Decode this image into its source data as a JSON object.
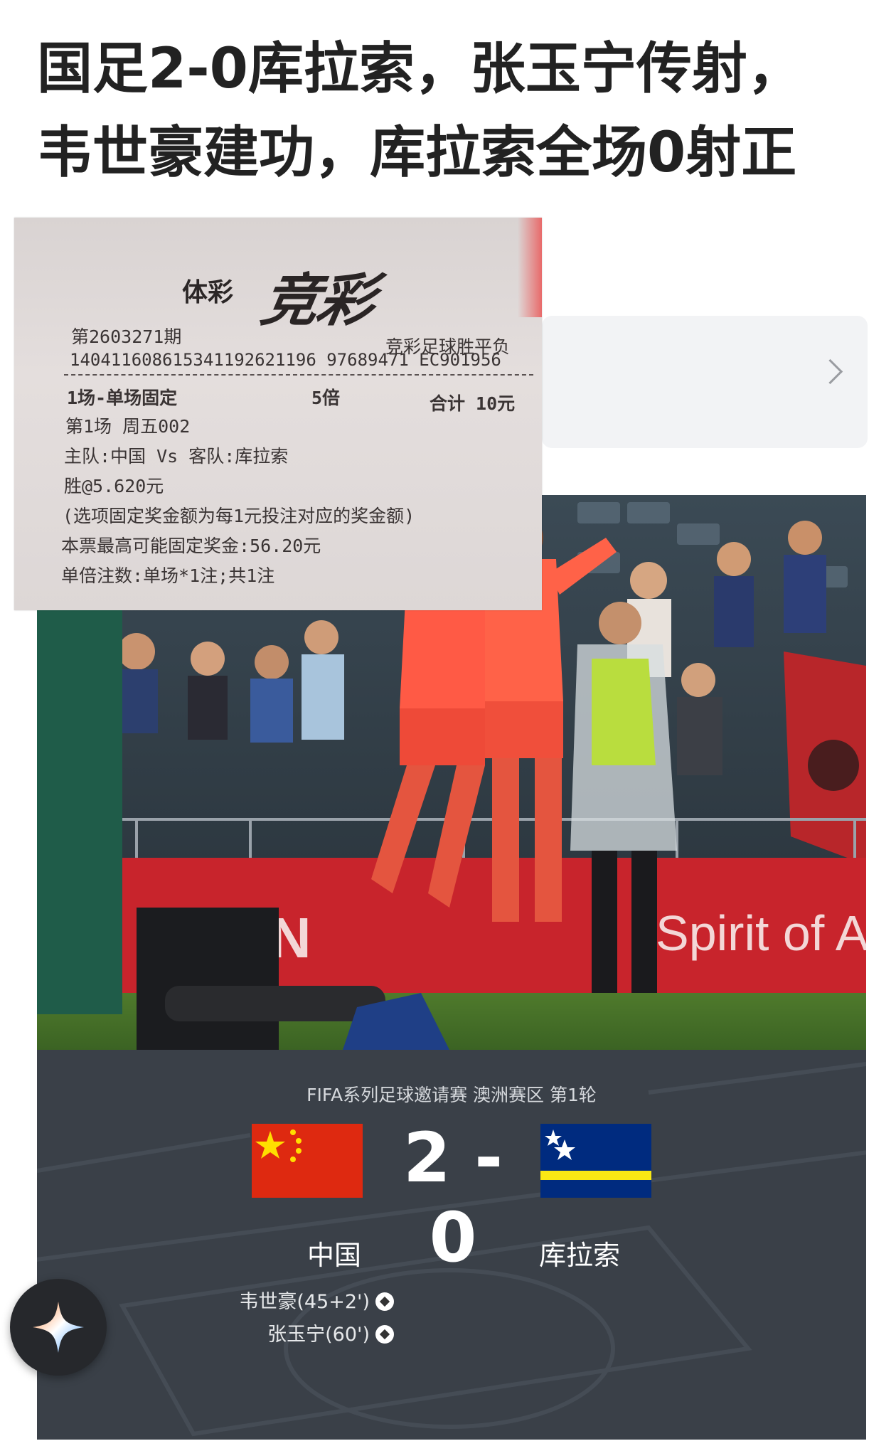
{
  "article": {
    "headline_line1": "国足2-0库拉索，张玉宁传射，",
    "headline_line2": "韦世豪建功，库拉索全场0射正"
  },
  "ticket": {
    "brand": "体彩",
    "logo": "竞彩",
    "issue": "第2603271期",
    "game_type": "竞彩足球胜平负",
    "serial": "140411608615341192621196 97689471 EC901956",
    "match_count_label": "1场-单场固定",
    "multiplier": "5倍",
    "total": "合计 10元",
    "match_line": "第1场    周五002",
    "teams_line": "主队:中国 Vs 客队:库拉索",
    "pick": "胜@5.620元",
    "note": "(选项固定奖金额为每1元投注对应的奖金额)",
    "max_prize": "本票最高可能固定奖金:56.20元",
    "bets": "单倍注数:单场*1注;共1注"
  },
  "photo": {
    "banner_text": "Spirit of A",
    "banner_left": "AN"
  },
  "match": {
    "competition": "FIFA系列足球邀请赛  澳洲赛区  第1轮",
    "score": "2 - 0",
    "home_team": "中国",
    "away_team": "库拉索",
    "scorers": [
      {
        "text": "韦世豪(45+2')",
        "icon": "soccer-ball-icon"
      },
      {
        "text": "张玉宁(60')",
        "icon": "soccer-ball-icon"
      }
    ]
  },
  "colors": {
    "china_red": "#de2910",
    "china_yellow": "#ffde00",
    "curacao_blue": "#002b7f",
    "curacao_yellow": "#f9e814",
    "panel": "#3a4048"
  },
  "icons": {
    "card_arrow": "chevron-right-icon",
    "fab": "sparkle-icon"
  }
}
